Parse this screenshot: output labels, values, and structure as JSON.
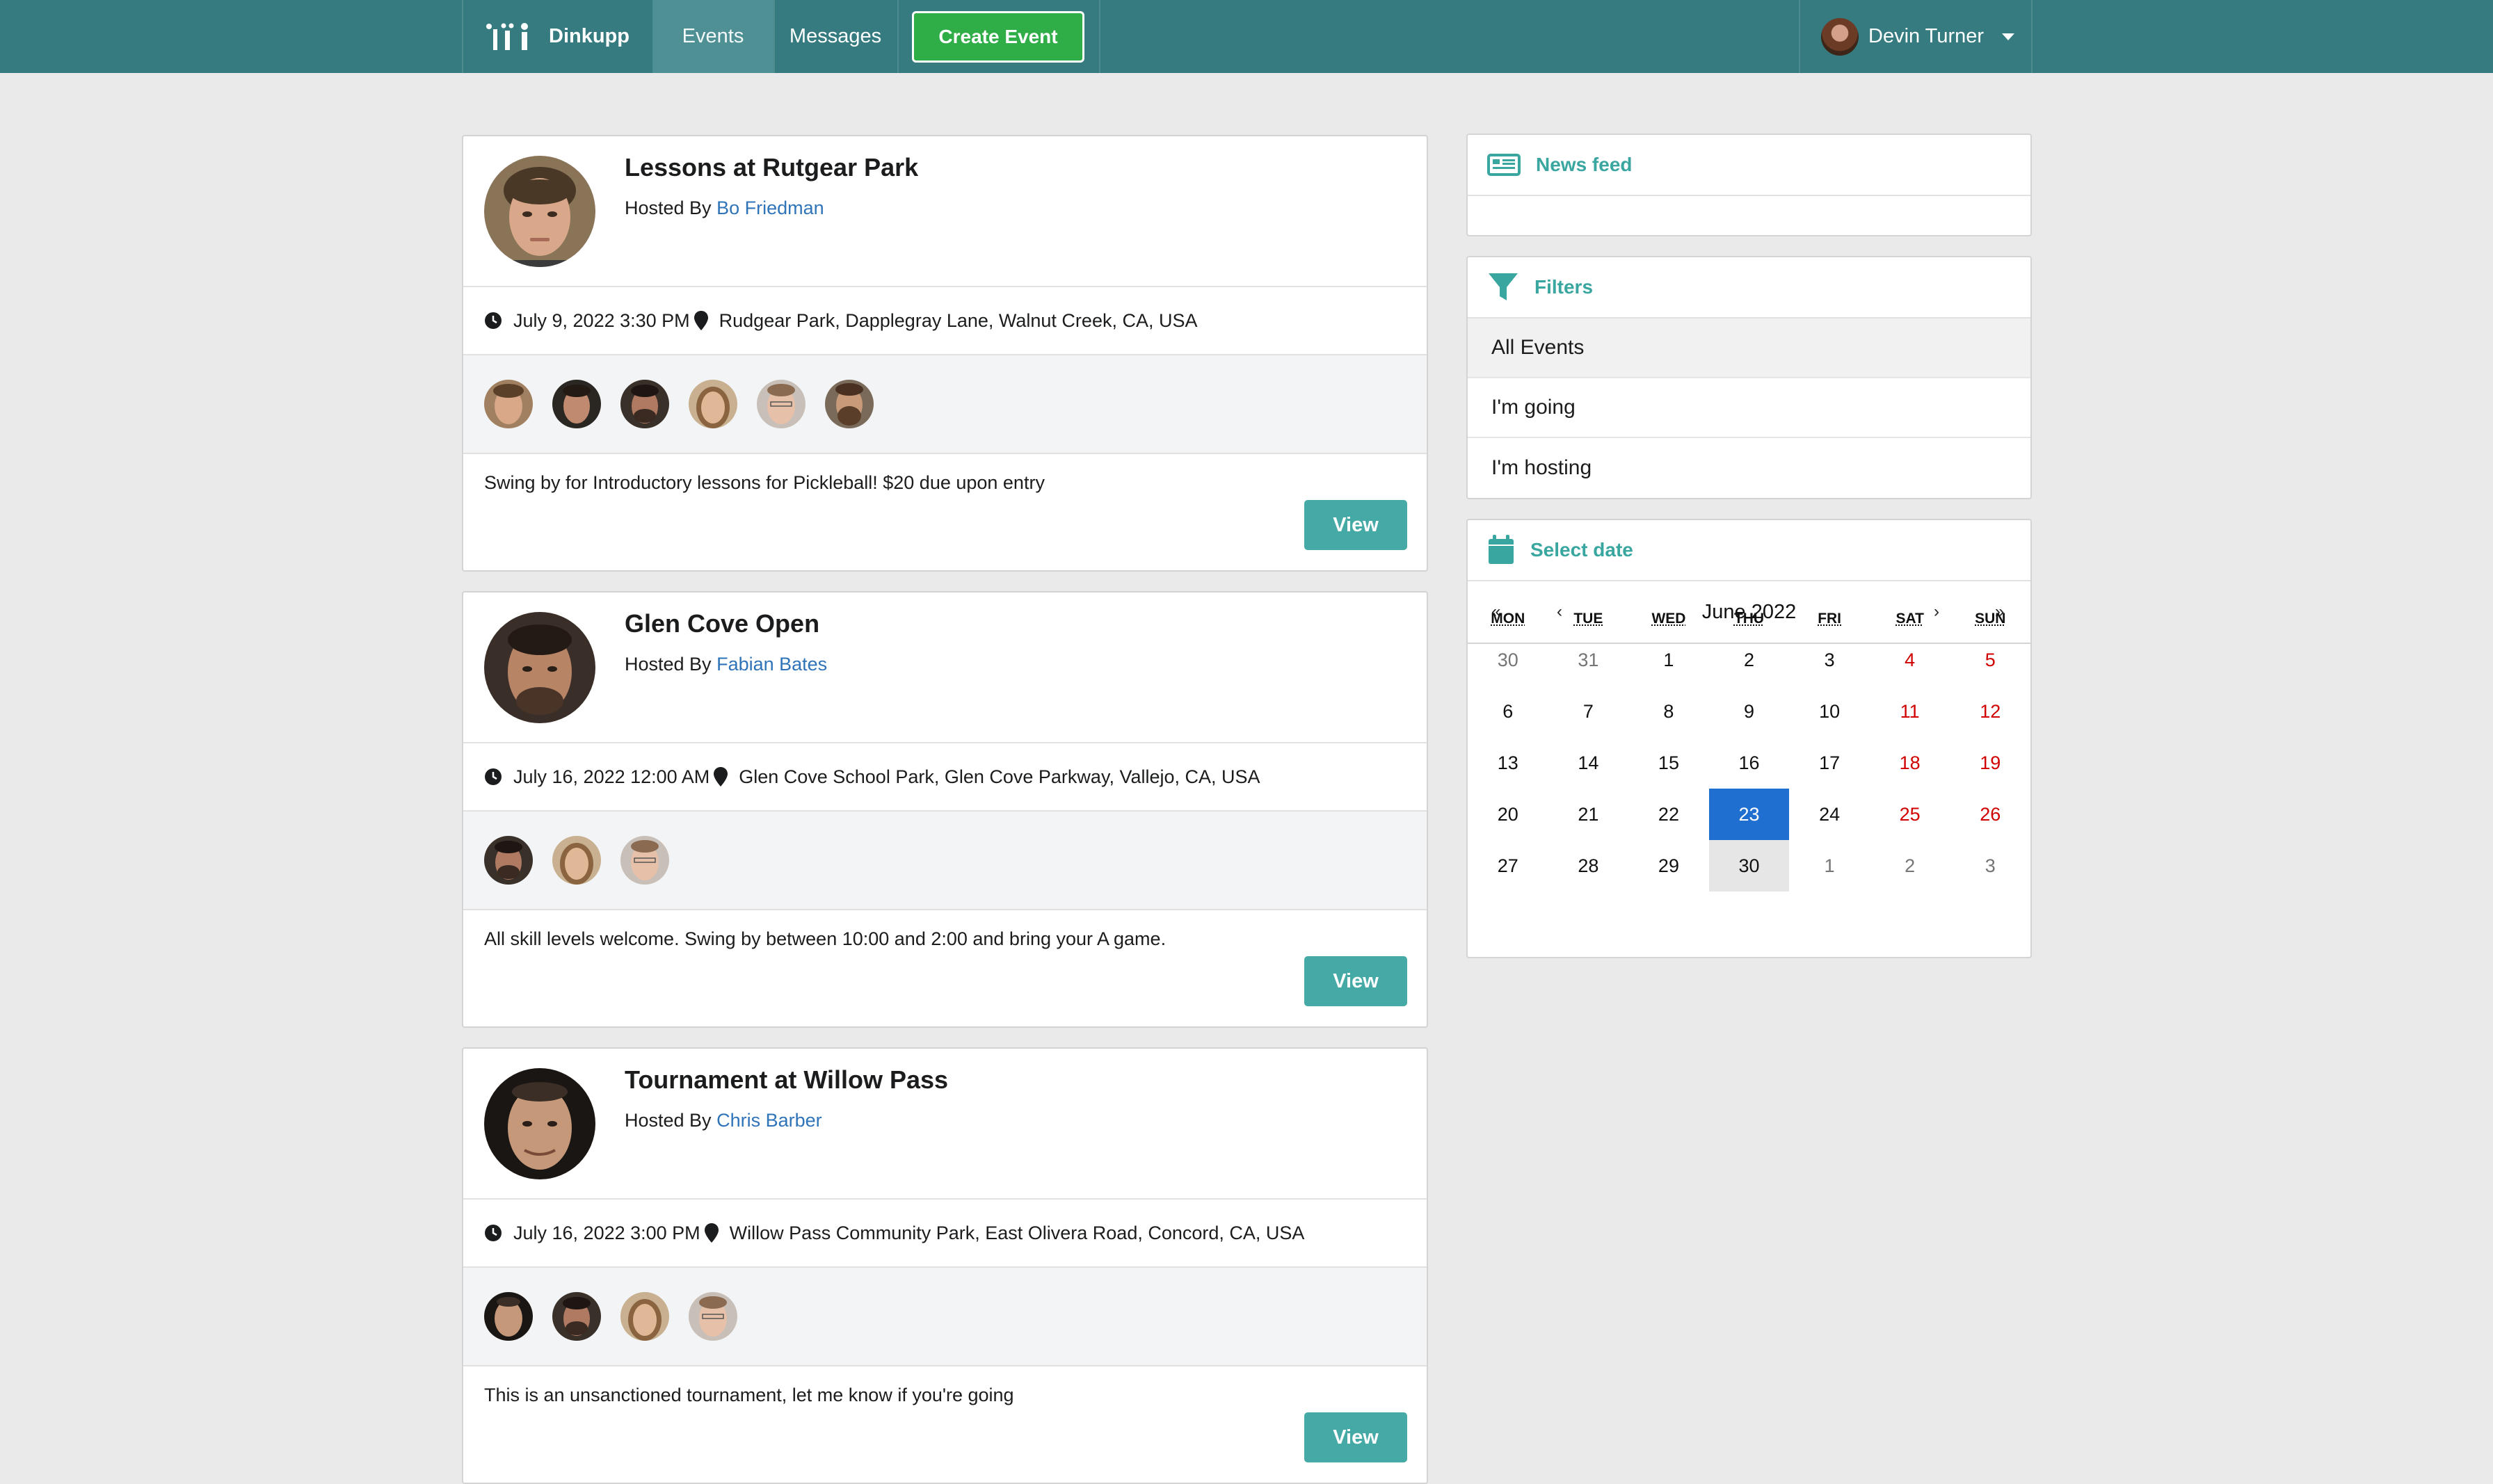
{
  "nav": {
    "app_name": "Dinkupp",
    "items": [
      {
        "label": "Events",
        "active": true
      },
      {
        "label": "Messages",
        "active": false
      }
    ],
    "create_label": "Create Event",
    "user_name": "Devin Turner"
  },
  "events": [
    {
      "title": "Lessons at Rutgear Park",
      "hosted_by_label": "Hosted By",
      "host": "Bo Friedman",
      "datetime": "July 9, 2022 3:30 PM",
      "location": "Rudgear Park, Dapplegray Lane, Walnut Creek, CA, USA",
      "attendee_count": 6,
      "description": "Swing by for Introductory lessons for Pickleball! $20 due upon entry",
      "view_label": "View"
    },
    {
      "title": "Glen Cove Open",
      "hosted_by_label": "Hosted By",
      "host": "Fabian Bates",
      "datetime": "July 16, 2022 12:00 AM",
      "location": "Glen Cove School Park, Glen Cove Parkway, Vallejo, CA, USA",
      "attendee_count": 3,
      "description": "All skill levels welcome. Swing by between 10:00 and 2:00 and bring your A game.",
      "view_label": "View"
    },
    {
      "title": "Tournament at Willow Pass",
      "hosted_by_label": "Hosted By",
      "host": "Chris Barber",
      "datetime": "July 16, 2022 3:00 PM",
      "location": "Willow Pass Community Park, East Olivera Road, Concord, CA, USA",
      "attendee_count": 4,
      "description": "This is an unsanctioned tournament, let me know if you're going",
      "view_label": "View"
    }
  ],
  "sidebar": {
    "news_feed_label": "News feed",
    "filters_label": "Filters",
    "filters": [
      "All Events",
      "I'm going",
      "I'm hosting"
    ],
    "active_filter": "All Events",
    "select_date_label": "Select date"
  },
  "calendar": {
    "nav": {
      "prev_year": "«",
      "prev_month": "‹",
      "next_month": "›",
      "next_year": "»"
    },
    "month_label": "June 2022",
    "weekdays": [
      "MON",
      "TUE",
      "WED",
      "THU",
      "FRI",
      "SAT",
      "SUN"
    ],
    "weeks": [
      [
        "30",
        "31",
        "1",
        "2",
        "3",
        "4",
        "5"
      ],
      [
        "6",
        "7",
        "8",
        "9",
        "10",
        "11",
        "12"
      ],
      [
        "13",
        "14",
        "15",
        "16",
        "17",
        "18",
        "19"
      ],
      [
        "20",
        "21",
        "22",
        "23",
        "24",
        "25",
        "26"
      ],
      [
        "27",
        "28",
        "29",
        "30",
        "1",
        "2",
        "3"
      ]
    ],
    "selected_day": "23",
    "today_day": "30"
  },
  "colors": {
    "nav_bg": "#357b7f",
    "accent": "#45aaa6",
    "create_button": "#2fae48",
    "link": "#2f73b8",
    "selected_day": "#1f6fd1",
    "weekend": "#d10000"
  },
  "icons": {
    "logo": "dinkupp-logo-icon",
    "clock": "clock-icon",
    "pin": "map-pin-icon",
    "news": "newspaper-icon",
    "filter": "filter-icon",
    "calendar": "calendar-icon",
    "caret": "caret-down-icon"
  }
}
